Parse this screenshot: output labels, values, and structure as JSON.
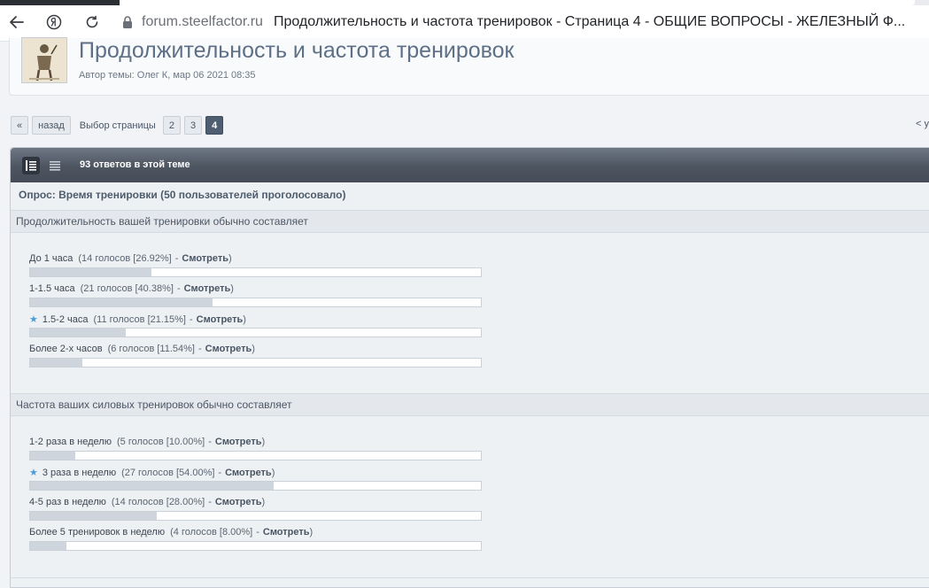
{
  "browser": {
    "domain": "forum.steelfactor.ru",
    "page_title": "Продолжительность и частота тренировок - Страница 4 - ОБЩИЕ ВОПРОСЫ - ЖЕЛЕЗНЫЙ Ф..."
  },
  "topic": {
    "title": "Продолжительность и частота тренировок",
    "author": "Автор темы: Олег К, мар 06 2021 08:35"
  },
  "pagination": {
    "first": "«",
    "prev": "назад",
    "label": "Выбор страницы",
    "pages": [
      "2",
      "3",
      "4"
    ],
    "current": "4",
    "right_fragment": "< y"
  },
  "thread": {
    "replies": "93 ответов в этой теме"
  },
  "poll": {
    "title": "Опрос: Время тренировки",
    "voters": "(50 пользователей проголосовало)",
    "view_label": "Смотреть",
    "questions": [
      {
        "text": "Продолжительность вашей тренировки обычно составляет",
        "options": [
          {
            "label": "До 1 часа",
            "votes": "(14 голосов [26.92%]",
            "percent": 26.92,
            "starred": false
          },
          {
            "label": "1-1.5 часа",
            "votes": "(21 голосов [40.38%]",
            "percent": 40.38,
            "starred": false
          },
          {
            "label": "1.5-2 часа",
            "votes": "(11 голосов [21.15%]",
            "percent": 21.15,
            "starred": true
          },
          {
            "label": "Более 2-х часов",
            "votes": "(6 голосов [11.54%]",
            "percent": 11.54,
            "starred": false
          }
        ]
      },
      {
        "text": "Частота ваших силовых тренировок обычно составляет",
        "options": [
          {
            "label": "1-2 раза в неделю",
            "votes": "(5 голосов [10.00%]",
            "percent": 10.0,
            "starred": false
          },
          {
            "label": "3 раза в неделю",
            "votes": "(27 голосов [54.00%]",
            "percent": 54.0,
            "starred": true
          },
          {
            "label": "4-5 раз в неделю",
            "votes": "(14 голосов [28.00%]",
            "percent": 28.0,
            "starred": false
          },
          {
            "label": "Более 5 тренировок в неделю",
            "votes": "(4 голосов [8.00%]",
            "percent": 8.0,
            "starred": false
          }
        ]
      }
    ]
  },
  "colors": {
    "title_blue": "#5d7087",
    "bar_fill": "#cfd5dc",
    "star_blue": "#4a9dd8",
    "header_dark": "#4d5561"
  }
}
